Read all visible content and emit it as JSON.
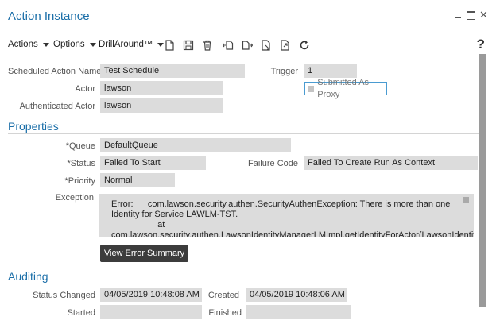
{
  "window": {
    "title": "Action Instance"
  },
  "toolbar": {
    "actions_label": "Actions",
    "options_label": "Options",
    "drillaround_label": "DrillAround™",
    "help_label": "?"
  },
  "header_fields": {
    "scheduled_action_name_label": "Scheduled Action Name",
    "scheduled_action_name_value": "Test Schedule",
    "trigger_label": "Trigger",
    "trigger_value": "1",
    "actor_label": "Actor",
    "actor_value": "lawson",
    "submitted_as_proxy_label": "Submitted As Proxy",
    "authenticated_actor_label": "Authenticated Actor",
    "authenticated_actor_value": "lawson"
  },
  "properties": {
    "section_title": "Properties",
    "queue_label": "*Queue",
    "queue_value": "DefaultQueue",
    "status_label": "*Status",
    "status_value": "Failed To Start",
    "failure_code_label": "Failure Code",
    "failure_code_value": "Failed To Create Run As Context",
    "priority_label": "*Priority",
    "priority_value": "Normal",
    "exception_label": "Exception",
    "exception_text": "Error:      com.lawson.security.authen.SecurityAuthenException: There is more than one Identity for Service LAWLM-TST.\n                   at\ncom.lawson.security.authen.LawsonIdentityManagerLMImpl.getIdentityForActor(LawsonIdentityMan",
    "view_error_summary_label": "View Error Summary"
  },
  "auditing": {
    "section_title": "Auditing",
    "status_changed_label": "Status Changed",
    "status_changed_value": "04/05/2019 10:48:08 AM",
    "created_label": "Created",
    "created_value": "04/05/2019 10:48:06 AM",
    "started_label": "Started",
    "started_value": "",
    "finished_label": "Finished",
    "finished_value": ""
  }
}
